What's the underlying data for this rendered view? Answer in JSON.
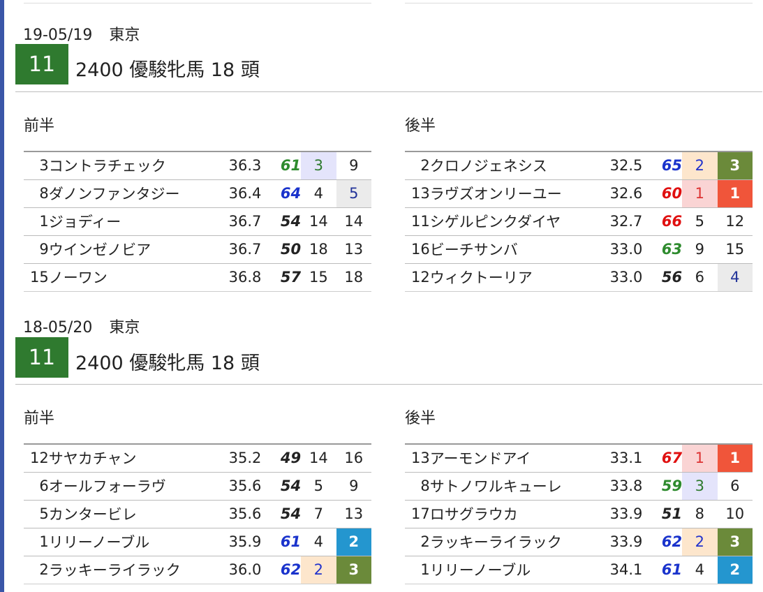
{
  "races": [
    {
      "date": "19-05/19",
      "venue": "東京",
      "race_no": "11",
      "title": "2400 優駿牝馬 18 頭",
      "first_half": {
        "label": "前半",
        "rows": [
          {
            "num": "3",
            "name": "コントラチェック",
            "time": "36.3",
            "score": "61",
            "rank1": "3",
            "rank2": "9"
          },
          {
            "num": "8",
            "name": "ダノンファンタジー",
            "time": "36.4",
            "score": "64",
            "rank1": "4",
            "rank2": "5"
          },
          {
            "num": "1",
            "name": "ジョディー",
            "time": "36.7",
            "score": "54",
            "rank1": "14",
            "rank2": "14"
          },
          {
            "num": "9",
            "name": "ウインゼノビア",
            "time": "36.7",
            "score": "50",
            "rank1": "18",
            "rank2": "13"
          },
          {
            "num": "15",
            "name": "ノーワン",
            "time": "36.8",
            "score": "57",
            "rank1": "15",
            "rank2": "18"
          }
        ]
      },
      "second_half": {
        "label": "後半",
        "rows": [
          {
            "num": "2",
            "name": "クロノジェネシス",
            "time": "32.5",
            "score": "65",
            "rank1": "2",
            "rank2": "3"
          },
          {
            "num": "13",
            "name": "ラヴズオンリーユー",
            "time": "32.6",
            "score": "60",
            "rank1": "1",
            "rank2": "1"
          },
          {
            "num": "11",
            "name": "シゲルピンクダイヤ",
            "time": "32.7",
            "score": "66",
            "rank1": "5",
            "rank2": "12"
          },
          {
            "num": "16",
            "name": "ビーチサンバ",
            "time": "33.0",
            "score": "63",
            "rank1": "9",
            "rank2": "15"
          },
          {
            "num": "12",
            "name": "ウィクトーリア",
            "time": "33.0",
            "score": "56",
            "rank1": "6",
            "rank2": "4"
          }
        ]
      }
    },
    {
      "date": "18-05/20",
      "venue": "東京",
      "race_no": "11",
      "title": "2400 優駿牝馬 18 頭",
      "first_half": {
        "label": "前半",
        "rows": [
          {
            "num": "12",
            "name": "サヤカチャン",
            "time": "35.2",
            "score": "49",
            "rank1": "14",
            "rank2": "16"
          },
          {
            "num": "6",
            "name": "オールフォーラヴ",
            "time": "35.6",
            "score": "54",
            "rank1": "5",
            "rank2": "9"
          },
          {
            "num": "5",
            "name": "カンタービレ",
            "time": "35.6",
            "score": "54",
            "rank1": "7",
            "rank2": "13"
          },
          {
            "num": "1",
            "name": "リリーノーブル",
            "time": "35.9",
            "score": "61",
            "rank1": "4",
            "rank2": "2"
          },
          {
            "num": "2",
            "name": "ラッキーライラック",
            "time": "36.0",
            "score": "62",
            "rank1": "2",
            "rank2": "3"
          }
        ]
      },
      "second_half": {
        "label": "後半",
        "rows": [
          {
            "num": "13",
            "name": "アーモンドアイ",
            "time": "33.1",
            "score": "67",
            "rank1": "1",
            "rank2": "1"
          },
          {
            "num": "8",
            "name": "サトノワルキューレ",
            "time": "33.8",
            "score": "59",
            "rank1": "3",
            "rank2": "6"
          },
          {
            "num": "17",
            "name": "ロサグラウカ",
            "time": "33.9",
            "score": "51",
            "rank1": "8",
            "rank2": "10"
          },
          {
            "num": "2",
            "name": "ラッキーライラック",
            "time": "33.9",
            "score": "62",
            "rank1": "2",
            "rank2": "3"
          },
          {
            "num": "1",
            "name": "リリーノーブル",
            "time": "34.1",
            "score": "61",
            "rank1": "4",
            "rank2": "2"
          }
        ]
      }
    }
  ]
}
